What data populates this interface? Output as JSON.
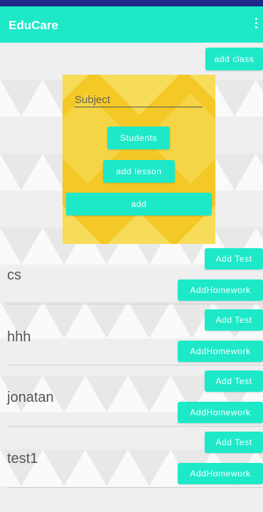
{
  "app": {
    "title": "EduCare"
  },
  "toolbar": {
    "add_class_label": "add class"
  },
  "form": {
    "subject_placeholder": "Subject",
    "students_label": "Students",
    "add_lesson_label": "add lesson",
    "add_label": "add"
  },
  "classes": [
    {
      "name": "cs",
      "add_test": "Add Test",
      "add_homework": "AddHomework"
    },
    {
      "name": "hhh",
      "add_test": "Add Test",
      "add_homework": "AddHomework"
    },
    {
      "name": "jonatan",
      "add_test": "Add Test",
      "add_homework": "AddHomework"
    },
    {
      "name": "test1",
      "add_test": "Add Test",
      "add_homework": "AddHomework"
    }
  ],
  "colors": {
    "accent": "#1de9c9",
    "card": "#f3c827",
    "status_bar": "#1f2a8a"
  },
  "icons": {
    "overflow": "overflow-menu-icon"
  }
}
